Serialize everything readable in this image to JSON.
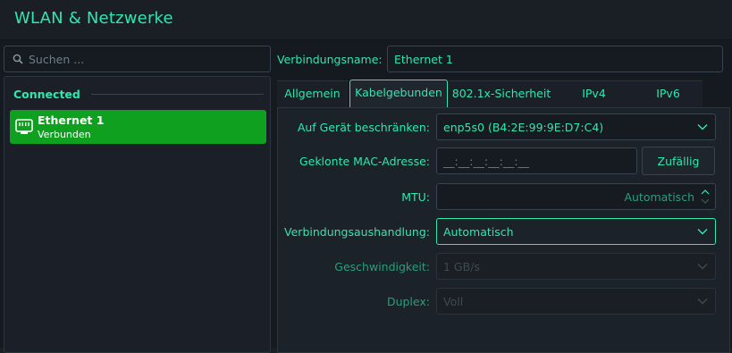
{
  "window": {
    "title": "WLAN & Netzwerke"
  },
  "sidebar": {
    "search": {
      "placeholder": "Suchen ..."
    },
    "section_title": "Connected",
    "connections": [
      {
        "name": "Ethernet 1",
        "status": "Verbunden",
        "selected": true,
        "icon": "ethernet-icon"
      }
    ]
  },
  "connection": {
    "name_label": "Verbindungsname:",
    "name_value": "Ethernet 1"
  },
  "tabs": [
    {
      "label": "Allgemein",
      "active": false
    },
    {
      "label": "Kabelgebunden",
      "active": true
    },
    {
      "label": "802.1x-Sicherheit",
      "active": false
    },
    {
      "label": "IPv4",
      "active": false
    },
    {
      "label": "IPv6",
      "active": false
    }
  ],
  "wired": {
    "device_label": "Auf Gerät beschränken:",
    "device_value": "enp5s0 (B4:2E:99:9E:D7:C4)",
    "mac_label": "Geklonte MAC-Adresse:",
    "mac_placeholder": "__:__:__:__:__:__",
    "random_button": "Zufällig",
    "mtu_label": "MTU:",
    "mtu_value": "Automatisch",
    "negotiation_label": "Verbindungsaushandlung:",
    "negotiation_value": "Automatisch",
    "speed_label": "Geschwindigkeit:",
    "speed_value": "1 GB/s",
    "duplex_label": "Duplex:",
    "duplex_value": "Voll"
  },
  "colors": {
    "accent": "#2ee8b0",
    "selected_bg": "#0ea01e",
    "window_bg": "#151a20"
  }
}
